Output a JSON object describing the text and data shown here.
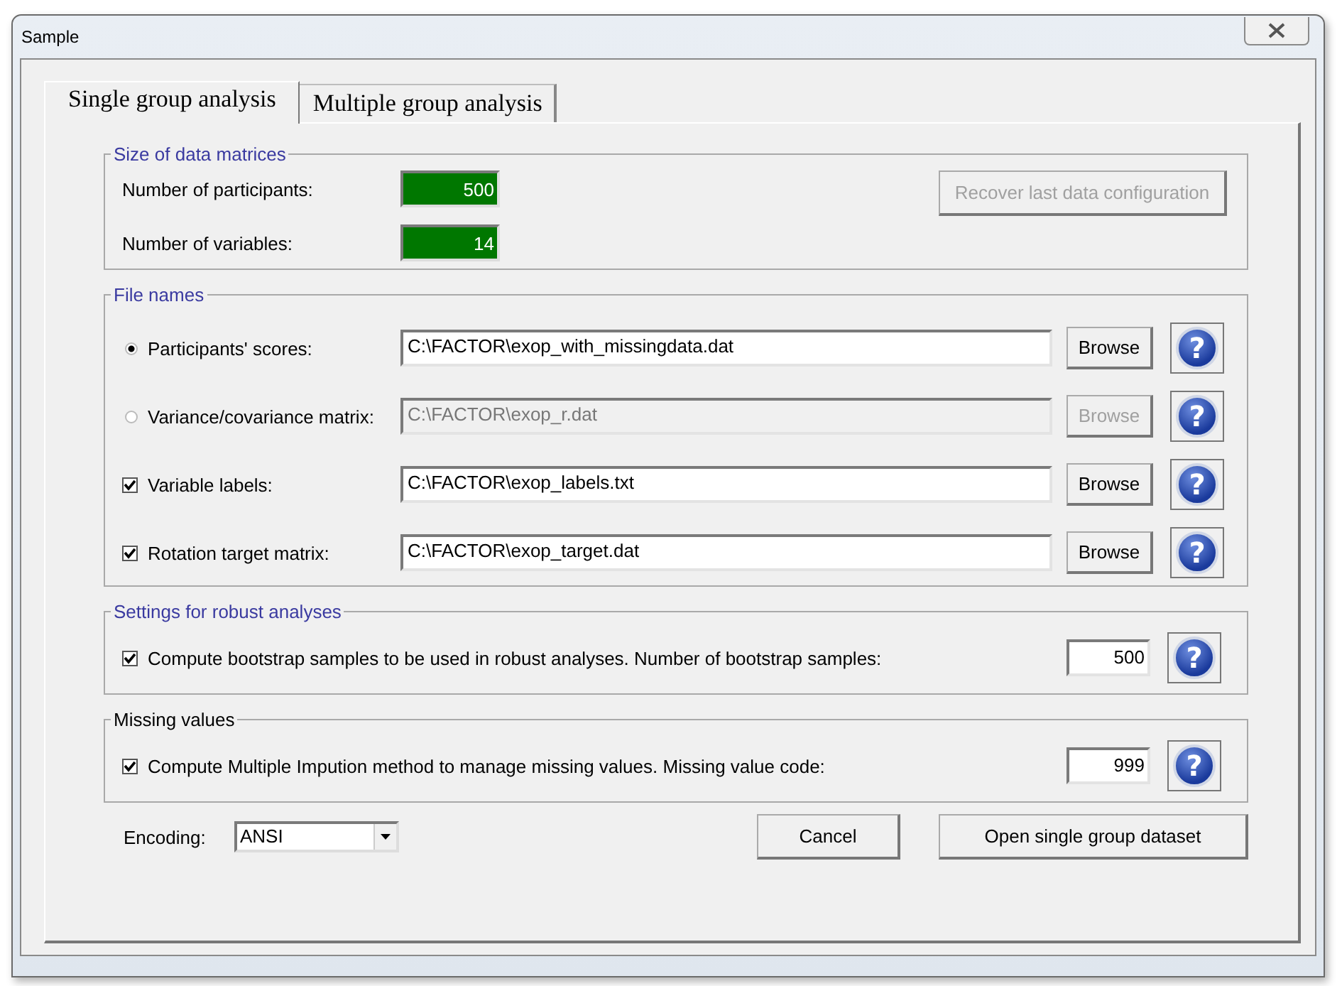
{
  "window": {
    "title": "Sample"
  },
  "tabs": [
    {
      "label": "Single group analysis",
      "selected": true
    },
    {
      "label": "Multiple group analysis",
      "selected": false
    }
  ],
  "size_group": {
    "title": "Size of data matrices",
    "color": "#3a3aa0",
    "fields": [
      {
        "label": "Number of participants:",
        "value": "500"
      },
      {
        "label": "Number of variables:",
        "value": "14"
      }
    ],
    "recover_button": {
      "label": "Recover last data configuration",
      "disabled": true
    }
  },
  "file_group": {
    "title": "File names",
    "color": "#3a3aa0",
    "rows": [
      {
        "kind": "radio",
        "label": "Participants' scores:",
        "checked": true,
        "value": "C:\\FACTOR\\exop_with_missingdata.dat",
        "disabled": false,
        "browse": "Browse",
        "help": "?"
      },
      {
        "kind": "radio",
        "label": "Variance/covariance matrix:",
        "checked": false,
        "value": "C:\\FACTOR\\exop_r.dat",
        "disabled": true,
        "browse": "Browse",
        "help": "?"
      },
      {
        "kind": "checkbox",
        "label": "Variable labels:",
        "checked": true,
        "value": "C:\\FACTOR\\exop_labels.txt",
        "disabled": false,
        "browse": "Browse",
        "help": "?"
      },
      {
        "kind": "checkbox",
        "label": "Rotation target matrix:",
        "checked": true,
        "value": "C:\\FACTOR\\exop_target.dat",
        "disabled": false,
        "browse": "Browse",
        "help": "?"
      }
    ]
  },
  "option_groups": [
    {
      "title": "Settings for robust analyses",
      "color": "#3a3aa0",
      "label": "Compute bootstrap samples to be used in robust analyses. Number of bootstrap samples:",
      "checked": true,
      "value": "500",
      "help": "?"
    },
    {
      "title": "Missing values",
      "color": "#000000",
      "label": "Compute Multiple Impution method to manage missing values. Missing value code:",
      "checked": true,
      "value": "999",
      "help": "?"
    }
  ],
  "encoding": {
    "label": "Encoding:",
    "value": "ANSI"
  },
  "buttons": [
    {
      "label": "Cancel"
    },
    {
      "label": "Open single group dataset"
    }
  ]
}
